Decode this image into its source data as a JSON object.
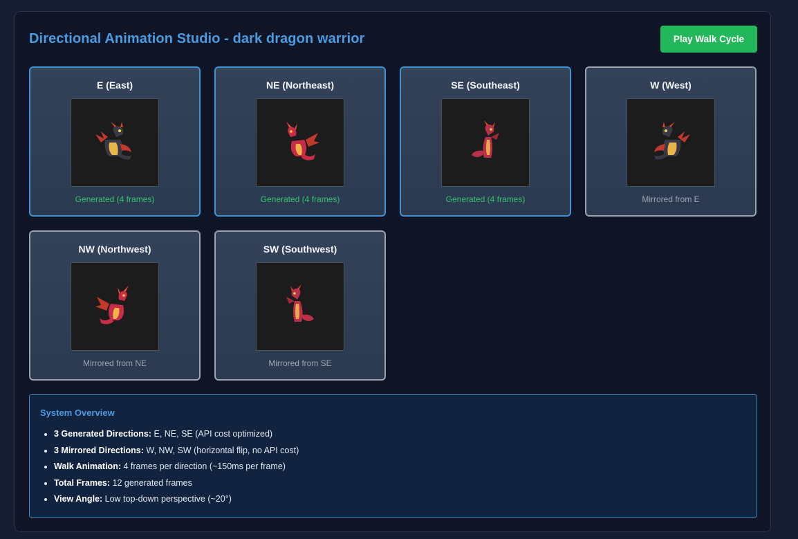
{
  "header": {
    "title": "Directional Animation Studio - dark dragon warrior",
    "play_button": "Play Walk Cycle"
  },
  "directions": [
    {
      "label": "E (East)",
      "status": "Generated (4 frames)",
      "kind": "generated",
      "sprite": "dragon-sprite-east"
    },
    {
      "label": "NE (Northeast)",
      "status": "Generated (4 frames)",
      "kind": "generated",
      "sprite": "dragon-sprite-northeast"
    },
    {
      "label": "SE (Southeast)",
      "status": "Generated (4 frames)",
      "kind": "generated",
      "sprite": "dragon-sprite-southeast"
    },
    {
      "label": "W (West)",
      "status": "Mirrored from E",
      "kind": "mirrored",
      "sprite": "dragon-sprite-west"
    },
    {
      "label": "NW (Northwest)",
      "status": "Mirrored from NE",
      "kind": "mirrored",
      "sprite": "dragon-sprite-northwest"
    },
    {
      "label": "SW (Southwest)",
      "status": "Mirrored from SE",
      "kind": "mirrored",
      "sprite": "dragon-sprite-southwest"
    }
  ],
  "overview": {
    "title": "System Overview",
    "items": [
      {
        "label": "3 Generated Directions:",
        "text": "E, NE, SE (API cost optimized)"
      },
      {
        "label": "3 Mirrored Directions:",
        "text": "W, NW, SW (horizontal flip, no API cost)"
      },
      {
        "label": "Walk Animation:",
        "text": "4 frames per direction (~150ms per frame)"
      },
      {
        "label": "Total Frames:",
        "text": "12 generated frames"
      },
      {
        "label": "View Angle:",
        "text": "Low top-down perspective (~20°)"
      }
    ]
  },
  "colors": {
    "accent_blue": "#4a9be0",
    "button_green": "#21b75a",
    "generated_text": "#33c46d",
    "mirrored_text": "#9ba5b3"
  }
}
